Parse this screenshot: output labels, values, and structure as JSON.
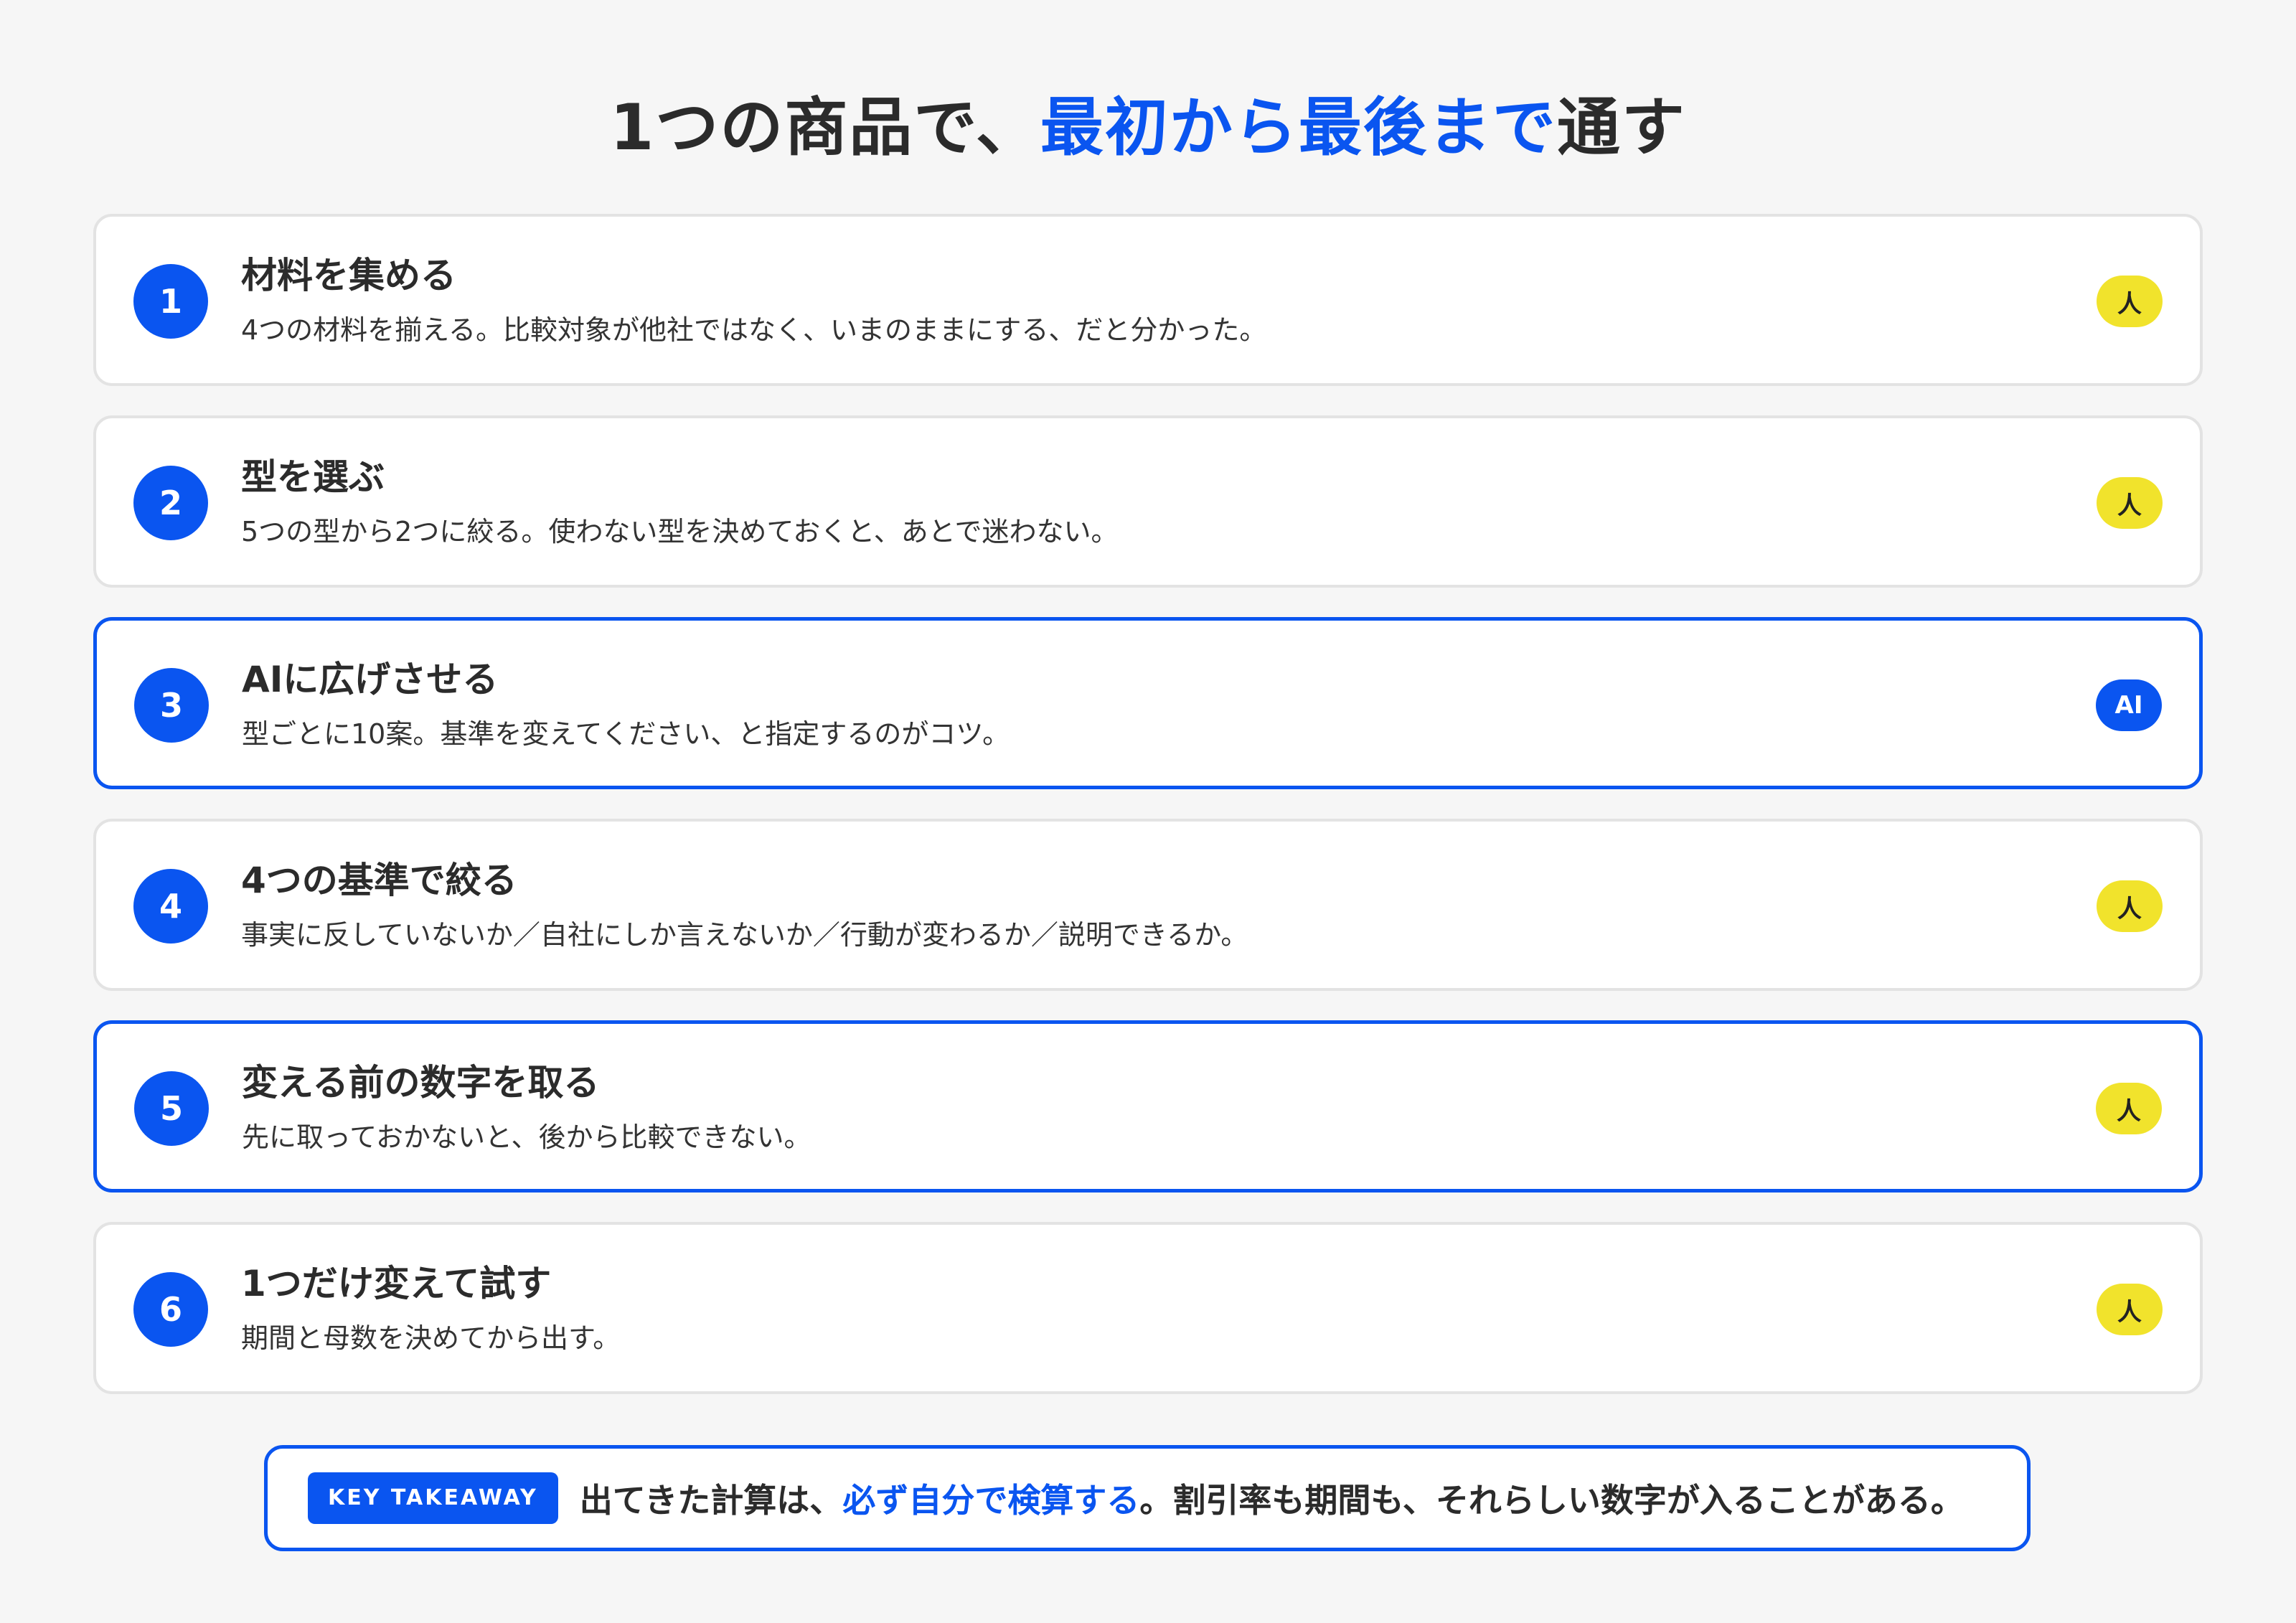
{
  "title": {
    "prefix": "1つの商品で、",
    "accent": "最初から最後まで",
    "suffix": "通す"
  },
  "steps": [
    {
      "number": "1",
      "title": "材料を集める",
      "desc": "4つの材料を揃える。比較対象が他社ではなく、いまのままにする、だと分かった。",
      "badge": "人",
      "highlight": false
    },
    {
      "number": "2",
      "title": "型を選ぶ",
      "desc": "5つの型から2つに絞る。使わない型を決めておくと、あとで迷わない。",
      "badge": "人",
      "highlight": false
    },
    {
      "number": "3",
      "title": "AIに広げさせる",
      "desc": "型ごとに10案。基準を変えてください、と指定するのがコツ。",
      "badge": "AI",
      "highlight": true
    },
    {
      "number": "4",
      "title": "4つの基準で絞る",
      "desc": "事実に反していないか／自社にしか言えないか／行動が変わるか／説明できるか。",
      "badge": "人",
      "highlight": false
    },
    {
      "number": "5",
      "title": "変える前の数字を取る",
      "desc": "先に取っておかないと、後から比較できない。",
      "badge": "人",
      "highlight": true
    },
    {
      "number": "6",
      "title": "1つだけ変えて試す",
      "desc": "期間と母数を決めてから出す。",
      "badge": "人",
      "highlight": false
    }
  ],
  "takeaway": {
    "tag": "KEY TAKEAWAY",
    "prefix": "出てきた計算は、",
    "accent": "必ず自分で検算する",
    "suffix": "。割引率も期間も、それらしい数字が入ることがある。"
  },
  "colors": {
    "accent": "#0a55f0",
    "human_badge": "#f1e32c",
    "background": "#f6f6f6"
  }
}
